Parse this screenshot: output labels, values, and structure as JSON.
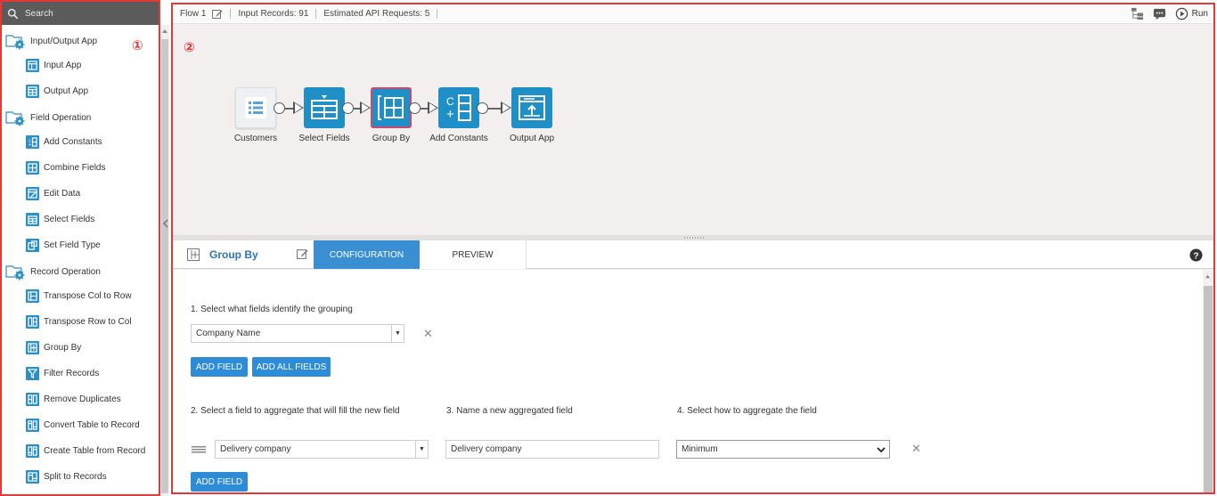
{
  "sidebar": {
    "search_placeholder": "Search",
    "marker": "①",
    "items": [
      {
        "kind": "category",
        "label": "Input/Output App"
      },
      {
        "kind": "tool",
        "label": "Input App",
        "icon": "table-input-icon"
      },
      {
        "kind": "tool",
        "label": "Output App",
        "icon": "table-output-icon"
      },
      {
        "kind": "category",
        "label": "Field Operation"
      },
      {
        "kind": "tool",
        "label": "Add Constants",
        "icon": "add-constants-icon"
      },
      {
        "kind": "tool",
        "label": "Combine Fields",
        "icon": "combine-fields-icon"
      },
      {
        "kind": "tool",
        "label": "Edit Data",
        "icon": "edit-data-icon"
      },
      {
        "kind": "tool",
        "label": "Select Fields",
        "icon": "select-fields-icon"
      },
      {
        "kind": "tool",
        "label": "Set Field Type",
        "icon": "set-field-type-icon"
      },
      {
        "kind": "category",
        "label": "Record Operation"
      },
      {
        "kind": "tool",
        "label": "Transpose Col to Row",
        "icon": "transpose-col-icon"
      },
      {
        "kind": "tool",
        "label": "Transpose Row to Col",
        "icon": "transpose-row-icon"
      },
      {
        "kind": "tool",
        "label": "Group By",
        "icon": "group-by-icon"
      },
      {
        "kind": "tool",
        "label": "Filter Records",
        "icon": "filter-icon"
      },
      {
        "kind": "tool",
        "label": "Remove Duplicates",
        "icon": "remove-duplicates-icon"
      },
      {
        "kind": "tool",
        "label": "Convert Table to Record",
        "icon": "convert-table-icon"
      },
      {
        "kind": "tool",
        "label": "Create Table from Record",
        "icon": "create-table-icon"
      },
      {
        "kind": "tool",
        "label": "Split to Records",
        "icon": "split-records-icon"
      }
    ]
  },
  "topbar": {
    "flow_name": "Flow 1",
    "input_records": "Input Records: 91",
    "estimated_requests": "Estimated API Requests: 5",
    "run_label": "Run"
  },
  "canvas": {
    "marker": "②",
    "nodes": [
      {
        "label": "Customers",
        "icon": "list-icon"
      },
      {
        "label": "Select Fields",
        "icon": "select-fields-icon"
      },
      {
        "label": "Group By",
        "icon": "group-by-icon"
      },
      {
        "label": "Add Constants",
        "icon": "add-constants-icon"
      },
      {
        "label": "Output App",
        "icon": "output-app-icon"
      }
    ]
  },
  "config": {
    "title": "Group By",
    "tabs": [
      "CONFIGURATION",
      "PREVIEW"
    ],
    "step1_label": "1. Select what fields identify the grouping",
    "grouping_value": "Company Name",
    "add_field": "ADD FIELD",
    "add_all_fields": "ADD ALL FIELDS",
    "step2_label": "2. Select a field to aggregate that will fill the new field",
    "step3_label": "3. Name a new aggregated field",
    "step4_label": "4. Select how to aggregate the field",
    "aggregate_field_value": "Delivery company",
    "aggregated_name_value": "Delivery company",
    "aggregation_method": "Minimum",
    "add_field_2": "ADD FIELD"
  }
}
